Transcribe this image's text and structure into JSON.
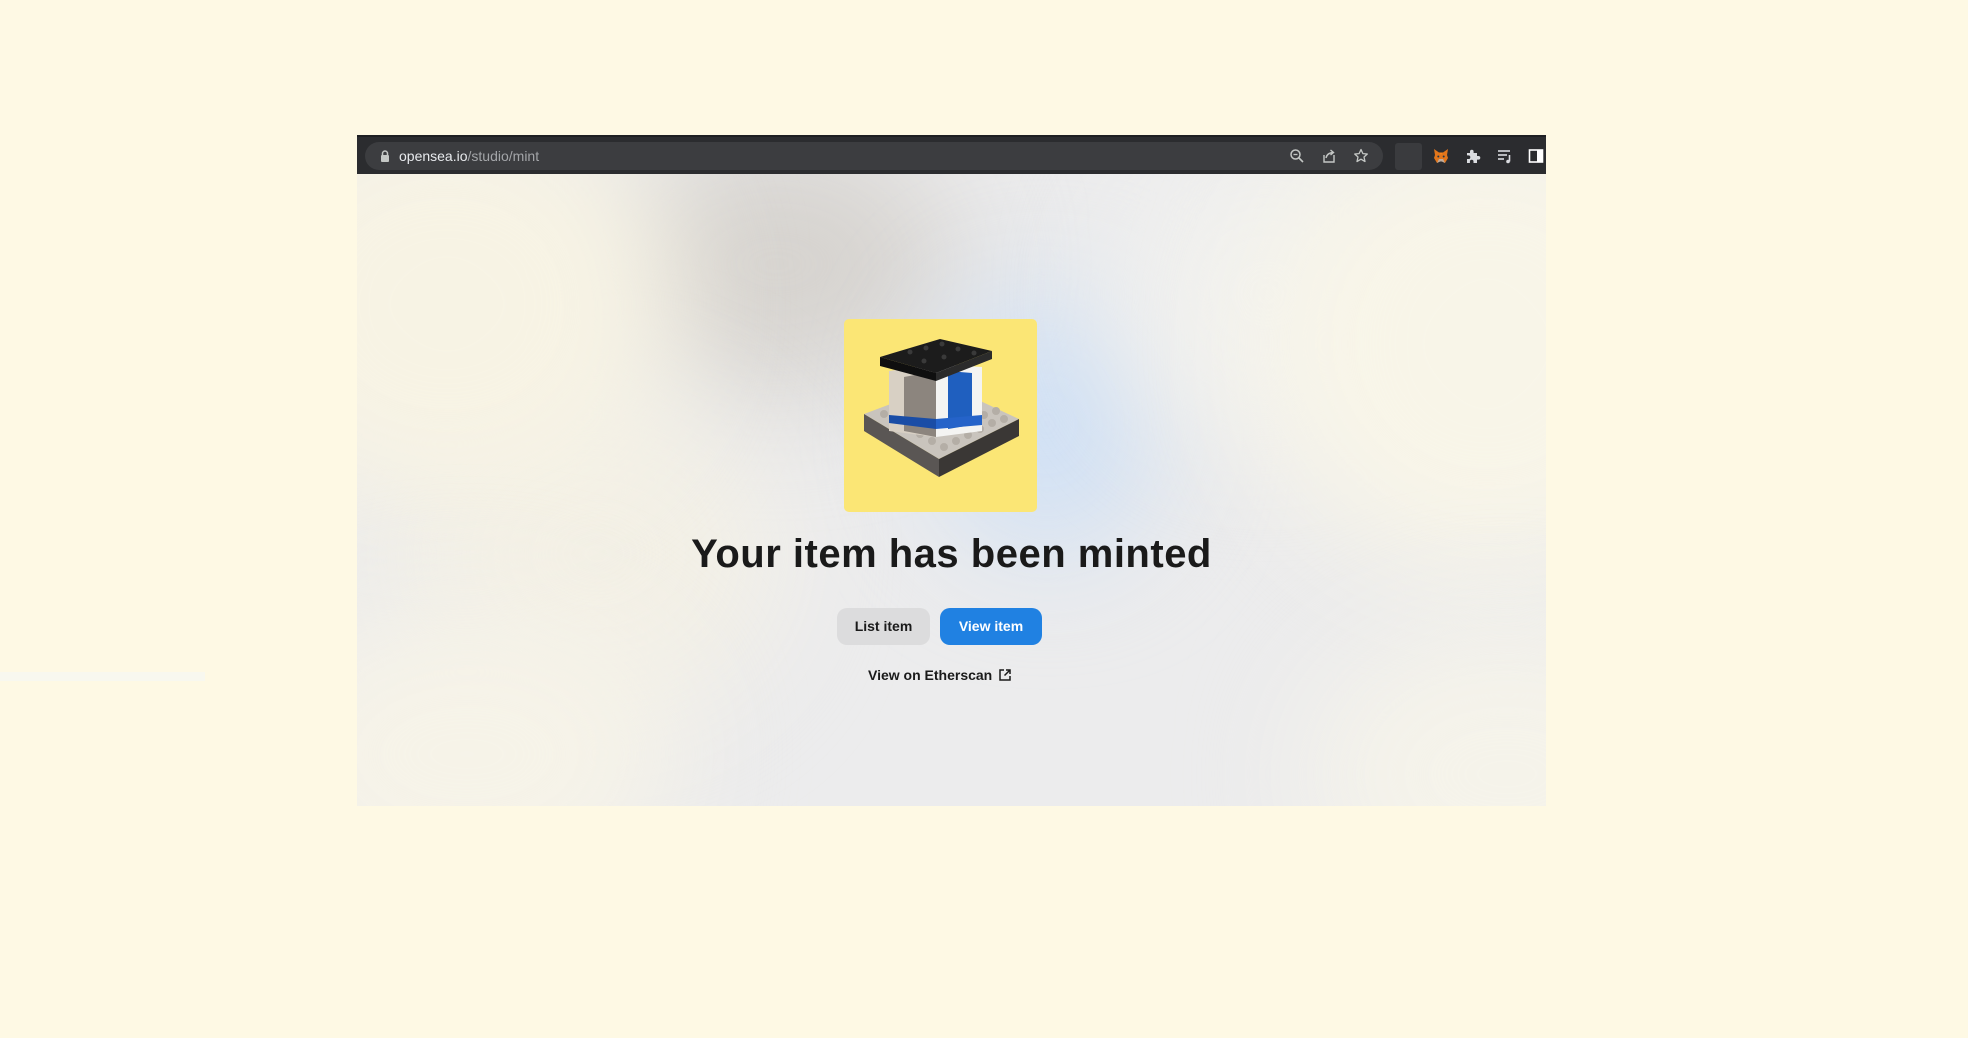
{
  "browser": {
    "url_domain": "opensea.io",
    "url_path": "/studio/mint",
    "icons": [
      "lock-icon",
      "zoom-icon",
      "share-icon",
      "bookmark-star-icon",
      "metamask-fox-icon",
      "extensions-puzzle-icon",
      "reading-list-icon",
      "side-panel-icon"
    ]
  },
  "main": {
    "nft_image": "lego-house-nft-image",
    "title": "Your item has been minted",
    "list_button": "List item",
    "view_button": "View item",
    "etherscan_link": "View on Etherscan",
    "etherscan_icon": "external-link-icon"
  },
  "colors": {
    "page_bg": "#fef9e4",
    "toolbar": "#2b2c2f",
    "omnibox": "#3c3d40",
    "primary_button": "#2081e2",
    "secondary_button": "#dcdcdd",
    "nft_background": "#fbe675"
  }
}
